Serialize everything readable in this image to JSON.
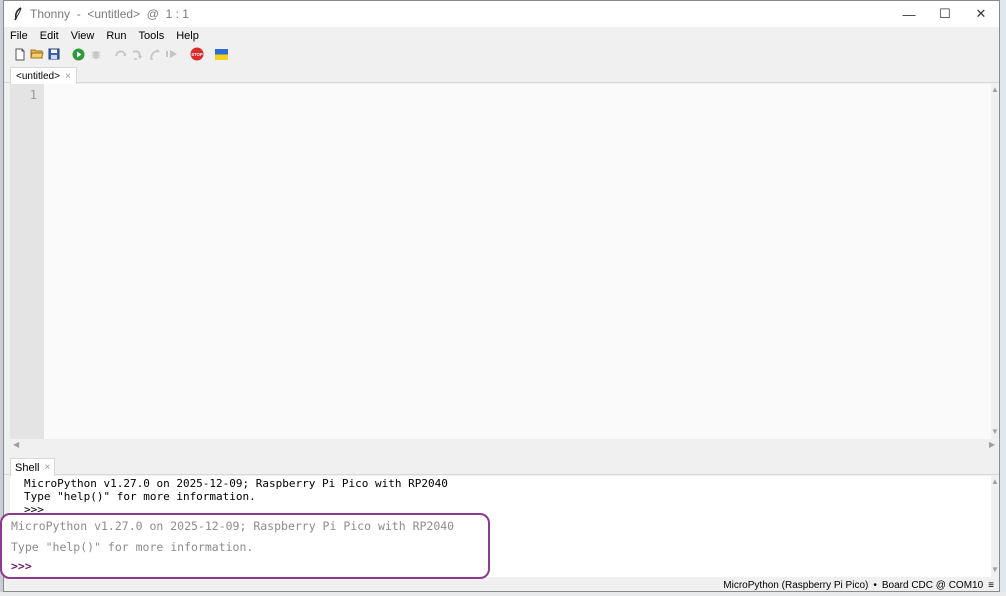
{
  "window": {
    "title": "Thonny  -  <untitled>  @  1 : 1",
    "controls": {
      "minimize": "—",
      "maximize": "☐",
      "close": "✕"
    }
  },
  "menubar": {
    "items": [
      "File",
      "Edit",
      "View",
      "Run",
      "Tools",
      "Help"
    ]
  },
  "toolbar": {
    "buttons": [
      {
        "name": "new-file-icon",
        "enabled": true
      },
      {
        "name": "open-folder-icon",
        "enabled": true
      },
      {
        "name": "save-icon",
        "enabled": true
      },
      {
        "name": "run-icon",
        "enabled": true
      },
      {
        "name": "debug-icon",
        "enabled": false
      },
      {
        "name": "step-over-icon",
        "enabled": false
      },
      {
        "name": "step-into-icon",
        "enabled": false
      },
      {
        "name": "step-out-icon",
        "enabled": false
      },
      {
        "name": "resume-icon",
        "enabled": false
      },
      {
        "name": "stop-icon",
        "enabled": true,
        "label": "STOP",
        "color": "#d92b2b"
      },
      {
        "name": "ukraine-flag-icon",
        "enabled": true,
        "colors": [
          "#2d6bd6",
          "#f7d117"
        ]
      }
    ]
  },
  "editor": {
    "tab_label": "<untitled>",
    "tab_close": "×",
    "line_numbers": [
      "1"
    ]
  },
  "shell": {
    "tab_label": "Shell",
    "tab_close": "×",
    "lines": [
      "MicroPython v1.27.0 on 2025-12-09; Raspberry Pi Pico with RP2040",
      "Type \"help()\" for more information.",
      ">>>"
    ]
  },
  "highlight": {
    "lines": [
      "MicroPython v1.27.0 on 2025-12-09; Raspberry Pi Pico with RP2040",
      "Type \"help()\" for more information."
    ],
    "prompt": ">>>",
    "border_color": "#8b3a8e"
  },
  "statusbar": {
    "interpreter": "MicroPython (Raspberry Pi Pico)",
    "separator": "•",
    "port": "Board CDC @ COM10",
    "menu_glyph": "≡"
  }
}
